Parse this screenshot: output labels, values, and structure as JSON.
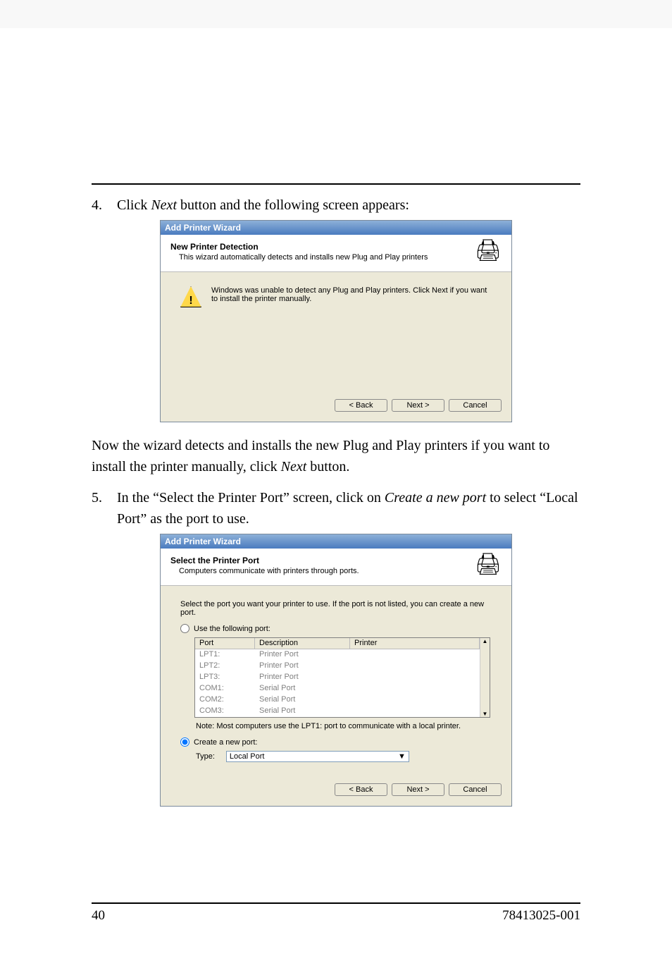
{
  "step4": {
    "num": "4.",
    "text_a": "Click ",
    "text_b": "Next",
    "text_c": " button and the following screen appears:"
  },
  "dlg1": {
    "title": "Add Printer Wizard",
    "header_title": "New Printer Detection",
    "header_sub": "This wizard automatically detects and installs new Plug and Play printers",
    "body": "Windows was unable to detect any Plug and Play printers. Click Next if you want to install the printer manually.",
    "btn_back": "< Back",
    "btn_next": "Next >",
    "btn_cancel": "Cancel"
  },
  "mid_para_a": "Now the wizard detects and installs the new Plug and Play printers if you want to install the printer manually, click ",
  "mid_para_b": "Next",
  "mid_para_c": " button.",
  "step5": {
    "num": "5.",
    "text_a": "In the “Select the Printer Port” screen, click on ",
    "text_b": "Create a new port",
    "text_c": " to select “Local Port” as the port to use."
  },
  "dlg2": {
    "title": "Add Printer Wizard",
    "header_title": "Select the Printer Port",
    "header_sub": "Computers communicate with printers through ports.",
    "hint": "Select the port you want your printer to use.  If the port is not listed, you can create a new port.",
    "radio_use": "Use the following port:",
    "col_port": "Port",
    "col_desc": "Description",
    "col_printer": "Printer",
    "rows": [
      {
        "port": "LPT1:",
        "desc": "Printer Port"
      },
      {
        "port": "LPT2:",
        "desc": "Printer Port"
      },
      {
        "port": "LPT3:",
        "desc": "Printer Port"
      },
      {
        "port": "COM1:",
        "desc": "Serial Port"
      },
      {
        "port": "COM2:",
        "desc": "Serial Port"
      },
      {
        "port": "COM3:",
        "desc": "Serial Port"
      }
    ],
    "note": "Note: Most computers use the LPT1: port to communicate with a local printer.",
    "radio_create": "Create a new port:",
    "type_label": "Type:",
    "type_value": "Local Port",
    "btn_back": "< Back",
    "btn_next": "Next >",
    "btn_cancel": "Cancel"
  },
  "footer": {
    "page": "40",
    "doc": "78413025-001"
  }
}
